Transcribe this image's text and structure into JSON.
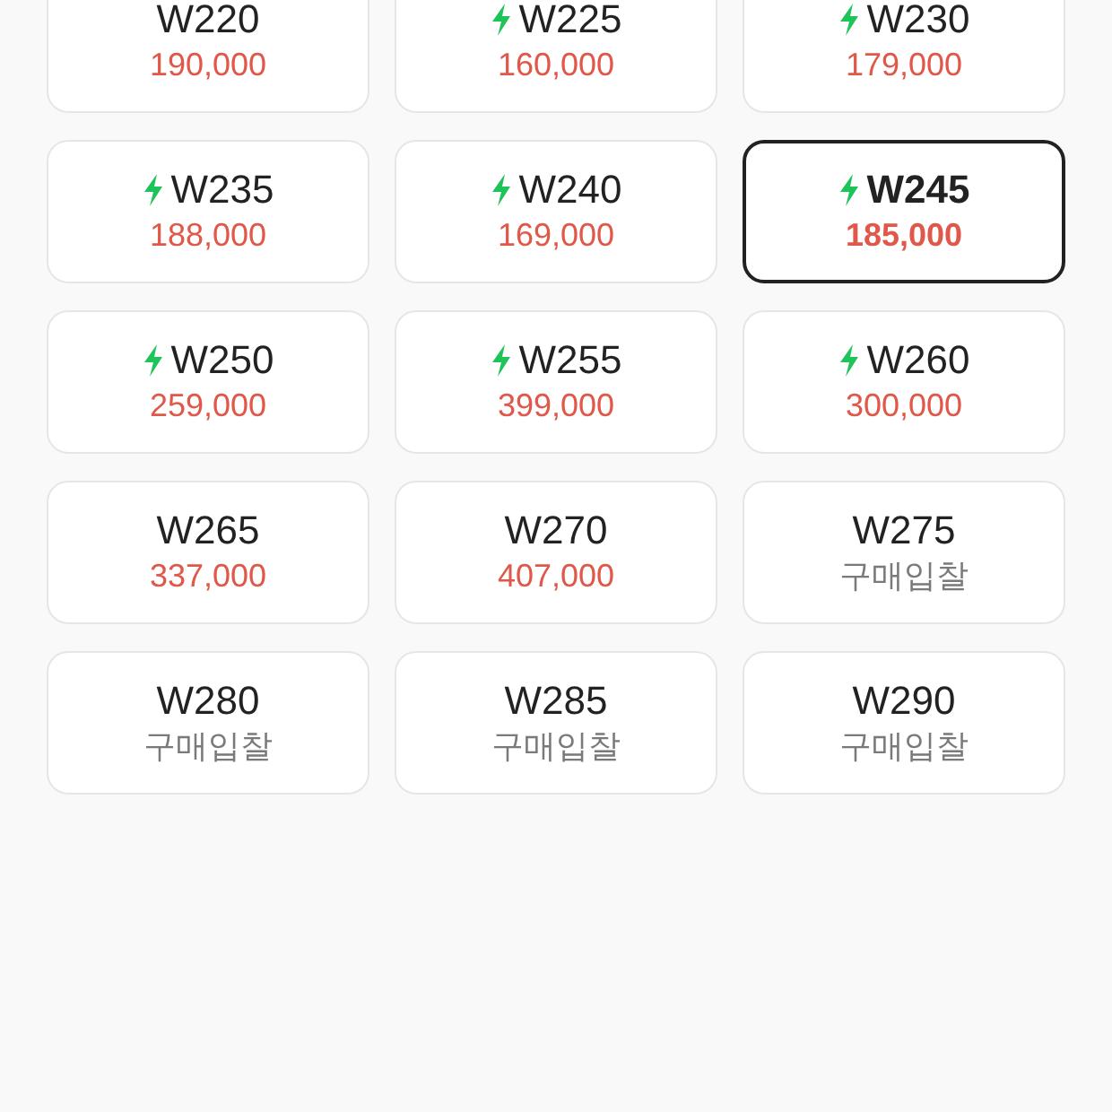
{
  "sizes": [
    {
      "size": "W220",
      "fast": false,
      "price": "190,000",
      "kind": "price",
      "selected": false
    },
    {
      "size": "W225",
      "fast": true,
      "price": "160,000",
      "kind": "price",
      "selected": false
    },
    {
      "size": "W230",
      "fast": true,
      "price": "179,000",
      "kind": "price",
      "selected": false
    },
    {
      "size": "W235",
      "fast": true,
      "price": "188,000",
      "kind": "price",
      "selected": false
    },
    {
      "size": "W240",
      "fast": true,
      "price": "169,000",
      "kind": "price",
      "selected": false
    },
    {
      "size": "W245",
      "fast": true,
      "price": "185,000",
      "kind": "price",
      "selected": true
    },
    {
      "size": "W250",
      "fast": true,
      "price": "259,000",
      "kind": "price",
      "selected": false
    },
    {
      "size": "W255",
      "fast": true,
      "price": "399,000",
      "kind": "price",
      "selected": false
    },
    {
      "size": "W260",
      "fast": true,
      "price": "300,000",
      "kind": "price",
      "selected": false
    },
    {
      "size": "W265",
      "fast": false,
      "price": "337,000",
      "kind": "price",
      "selected": false
    },
    {
      "size": "W270",
      "fast": false,
      "price": "407,000",
      "kind": "price",
      "selected": false
    },
    {
      "size": "W275",
      "fast": false,
      "price": "구매입찰",
      "kind": "bid",
      "selected": false
    },
    {
      "size": "W280",
      "fast": false,
      "price": "구매입찰",
      "kind": "bid",
      "selected": false
    },
    {
      "size": "W285",
      "fast": false,
      "price": "구매입찰",
      "kind": "bid",
      "selected": false
    },
    {
      "size": "W290",
      "fast": false,
      "price": "구매입찰",
      "kind": "bid",
      "selected": false
    }
  ]
}
